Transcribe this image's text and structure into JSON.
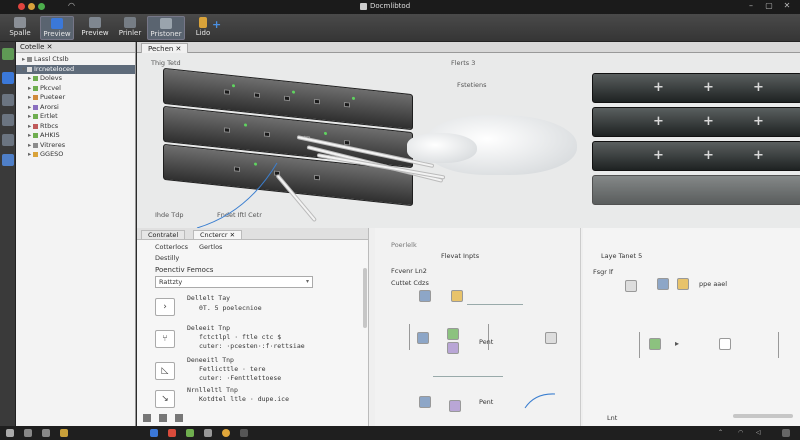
{
  "window": {
    "title": "Docmlibtod"
  },
  "toolbar": {
    "buttons": [
      {
        "label": "Spalle"
      },
      {
        "label": "Preview"
      },
      {
        "label": "Preview"
      },
      {
        "label": "Prinler"
      },
      {
        "label": "Pristoner"
      },
      {
        "label": "Lido"
      }
    ]
  },
  "explorer": {
    "tab_label": "Cotelle ✕",
    "items": [
      {
        "label": "Lassl Ctslb"
      },
      {
        "label": "Ircneteloced"
      },
      {
        "label": "Dolevs"
      },
      {
        "label": "Pkcvel"
      },
      {
        "label": "Pueteer"
      },
      {
        "label": "Arorsi"
      },
      {
        "label": "Ertlet"
      },
      {
        "label": "Rtbcs"
      },
      {
        "label": "AHKIS"
      },
      {
        "label": "Vitreres"
      },
      {
        "label": "GGESO"
      }
    ]
  },
  "main": {
    "tab_label": "Pechen ✕",
    "photo_panes": {
      "left_title": "Thig Tetd",
      "mid_title": "Flerts 3",
      "mid_sub": "Fstetiens",
      "footer_left": "Ihde Tdp",
      "footer_mid": "Fndet Iftl Cetr"
    }
  },
  "lower": {
    "tabs": [
      {
        "label": "Contratel"
      },
      {
        "label": "Cnctercr ✕"
      }
    ],
    "props": {
      "row1a": "Cotterlocs",
      "row1b": "Gertlos",
      "row2": "Destilly",
      "heading": "Poenctiv Femocs",
      "field_value": "Rattzty"
    },
    "code_blocks": [
      {
        "head": "Dellelt Tay",
        "l1": "0T. 5 poelecnioe",
        "l2": ""
      },
      {
        "head": "Deleeit Tnp",
        "l1": "fctctlpl · ftle ctc $",
        "l2": "cuter: ·pcesten·:f·rettsiae"
      },
      {
        "head": "Deneeitl Tnp",
        "l1": "Fetlicttle · tere",
        "l2": "cuter: ·Fenttlettoese"
      },
      {
        "head": "Nrnlleltl Tnp",
        "l1": "Kotdtel ltle · dupe.ice",
        "l2": ""
      }
    ],
    "diagram1": {
      "title": "Poerlelk",
      "sub": "Flevat Inpts",
      "header_label": "Fcvenr Ln2",
      "row1_label": "Cuttet Cdzs",
      "row2_label": "Pent",
      "row3_label": "Pent"
    },
    "diagram2": {
      "title": "Laye Tanet 5",
      "sub": "Fsgr lf",
      "node_label": "ppe aael",
      "footer": "Lnt"
    }
  },
  "colors": {
    "accent": "#2f6fd6",
    "selection": "#5e6b7a",
    "led": "#5fd35f",
    "wire": "#3b7fd0"
  }
}
